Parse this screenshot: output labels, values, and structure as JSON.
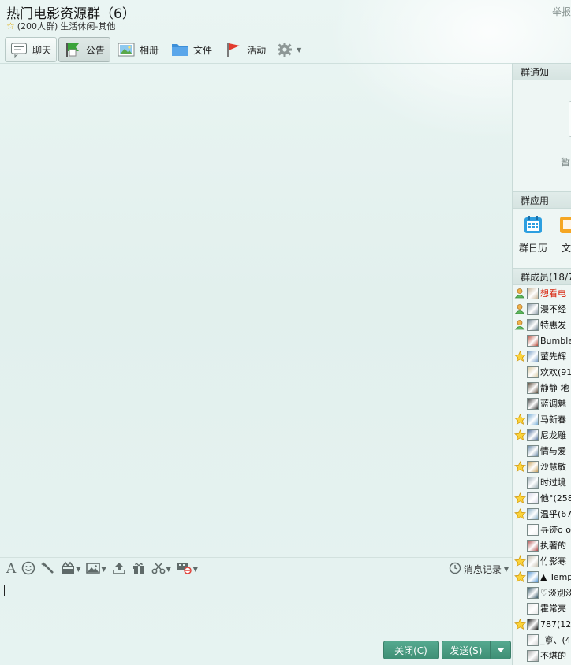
{
  "header": {
    "title": "热门电影资源群（6）",
    "member_count": "(200人群)",
    "category": "生活休闲-其他",
    "report_label": "举报"
  },
  "tabs": [
    {
      "label": "聊天",
      "icon": "chat-bubble-icon"
    },
    {
      "label": "公告",
      "icon": "announcement-flag-icon"
    },
    {
      "label": "相册",
      "icon": "photo-album-icon"
    },
    {
      "label": "文件",
      "icon": "folder-icon"
    },
    {
      "label": "活动",
      "icon": "activity-flag-icon"
    }
  ],
  "toolbar": {
    "history_label": "消息记录",
    "icons": [
      "font-icon",
      "emoji-icon",
      "magic-wand-icon",
      "gift-box-icon",
      "image-icon",
      "upload-icon",
      "gift-icon",
      "scissors-icon",
      "screen-block-icon",
      "clock-icon"
    ]
  },
  "buttons": {
    "close_label": "关闭(C)",
    "send_label": "发送(S)"
  },
  "sidebar": {
    "notice_header": "群通知",
    "notice_text": "暂",
    "apps_header": "群应用",
    "apps": [
      {
        "label": "群日历",
        "icon": "calendar-icon"
      },
      {
        "label": "文",
        "icon": "document-icon"
      }
    ],
    "members_header": "群成员(18/7",
    "members": [
      {
        "name": "想看电",
        "role": "owner",
        "highlight": true
      },
      {
        "name": "漫不经",
        "role": "owner"
      },
      {
        "name": "特惠发",
        "role": "owner"
      },
      {
        "name": "Bumbleb",
        "role": "none"
      },
      {
        "name": "萤先辉",
        "role": "star"
      },
      {
        "name": "欢欢(91",
        "role": "none"
      },
      {
        "name": "静静 地",
        "role": "none"
      },
      {
        "name": "蓝调魅",
        "role": "none"
      },
      {
        "name": "马新春",
        "role": "star"
      },
      {
        "name": "尼龙雕",
        "role": "star"
      },
      {
        "name": "情与爱",
        "role": "none"
      },
      {
        "name": "沙慧敏",
        "role": "star"
      },
      {
        "name": "时过境",
        "role": "none"
      },
      {
        "name": "他°(258",
        "role": "star"
      },
      {
        "name": "温乎(67",
        "role": "star"
      },
      {
        "name": "寻迹o o",
        "role": "none"
      },
      {
        "name": "执著的",
        "role": "none"
      },
      {
        "name": "竹影寒",
        "role": "star"
      },
      {
        "name": "▲ Temp",
        "role": "star"
      },
      {
        "name": "♡淡别淡",
        "role": "none"
      },
      {
        "name": "霍常亮",
        "role": "none"
      },
      {
        "name": "787(126",
        "role": "star"
      },
      {
        "name": "_寧、(4",
        "role": "none"
      },
      {
        "name": "不堪的",
        "role": "none"
      }
    ]
  }
}
